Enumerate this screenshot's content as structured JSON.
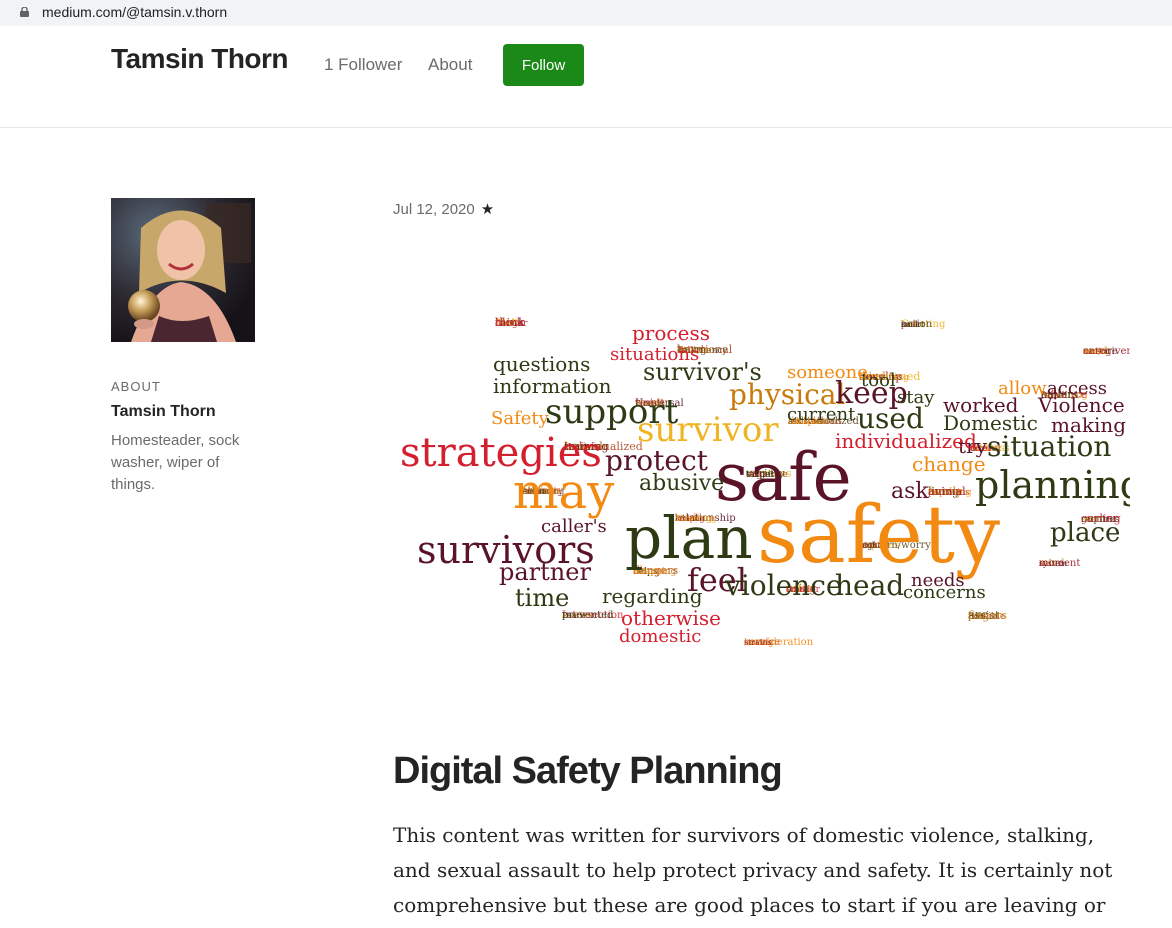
{
  "browser": {
    "url": "medium.com/@tamsin.v.thorn"
  },
  "header": {
    "site_name": "Tamsin Thorn",
    "followers": "1 Follower",
    "about": "About",
    "follow": "Follow"
  },
  "sidebar": {
    "about_label": "ABOUT",
    "name": "Tamsin Thorn",
    "bio": "Homesteader, sock washer, wiper of things."
  },
  "post": {
    "date": "Jul 12, 2020",
    "star": "★",
    "title": "Digital Safety Planning",
    "body": "This content was written for survivors of domestic violence, stalking, and sexual assault to help protect privacy and safety. It is certainly not comprehensive but these are good places to start if you are leaving or"
  },
  "wordcloud": {
    "words": [
      "safety",
      "safe",
      "plan",
      "may",
      "strategies",
      "survivors",
      "planning",
      "support",
      "survivor",
      "survivor's",
      "physical",
      "feel",
      "violence",
      "head",
      "protect",
      "used",
      "keep",
      "situation",
      "questions",
      "information",
      "place",
      "Violence",
      "Domestic",
      "worked",
      "abusive",
      "access",
      "allow",
      "partner",
      "time",
      "regarding",
      "otherwise",
      "domestic",
      "needs",
      "concerns",
      "caller's",
      "process",
      "situations",
      "ask",
      "tool",
      "stay",
      "making",
      "try",
      "change",
      "individualized",
      "someone",
      "current",
      "Safety",
      "block",
      "smart",
      "devices",
      "caregivers",
      "threatened",
      "Florida",
      "Mind",
      "unique",
      "training",
      "takes",
      "target",
      "obvious",
      "animal",
      "Screening",
      "requires",
      "sexual",
      "abuse",
      "system",
      "smaller",
      "prevented",
      "fingers",
      "strains",
      "BIAF",
      "action",
      "emotional",
      "work",
      "measures",
      "result",
      "callers",
      "Advocates",
      "short",
      "address",
      "variety",
      "Although",
      "depriving",
      "relationship",
      "curling",
      "might",
      "wrapping",
      "moment",
      "refer",
      "Peace",
      "possible",
      "consideration",
      "think",
      "past",
      "emergency",
      "need",
      "develop",
      "identify",
      "far",
      "limitations",
      "become",
      "act",
      "stop",
      "seem",
      "family",
      "locking",
      "ever",
      "concern/worry",
      "dangers",
      "aids",
      "one",
      "Intersection",
      "assist",
      "leaving",
      "danger",
      "Creating",
      "harm",
      "and/or",
      "controlling",
      "Universal",
      "advance",
      "assistive",
      "things",
      "useful",
      "services",
      "enhancing",
      "partner's",
      "leading",
      "corner",
      "hard",
      "helps",
      "mind",
      "using",
      "another",
      "RFC",
      "service",
      "Note",
      "back",
      "Talk",
      "ensure",
      "tried",
      "face",
      "remaining",
      "individualized",
      "Individualized",
      "discuss",
      "cognitive",
      "memory",
      "living",
      "adapt",
      "go",
      "requires"
    ]
  }
}
